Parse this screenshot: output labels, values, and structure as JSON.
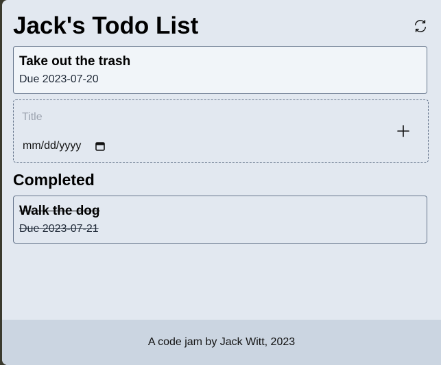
{
  "app": {
    "title": "Jack's Todo List"
  },
  "todos": [
    {
      "title": "Take out the trash",
      "due": "Due 2023-07-20"
    }
  ],
  "new_todo": {
    "title_placeholder": "Title",
    "title_value": "",
    "date_placeholder": "mm/dd/yyyy"
  },
  "completed": {
    "heading": "Completed",
    "items": [
      {
        "title": "Walk the dog",
        "due": "Due 2023-07-21"
      }
    ]
  },
  "footer": {
    "text": "A code jam by Jack Witt, 2023"
  },
  "icons": {
    "refresh": "refresh-icon",
    "add": "plus-icon",
    "calendar": "calendar-icon"
  }
}
